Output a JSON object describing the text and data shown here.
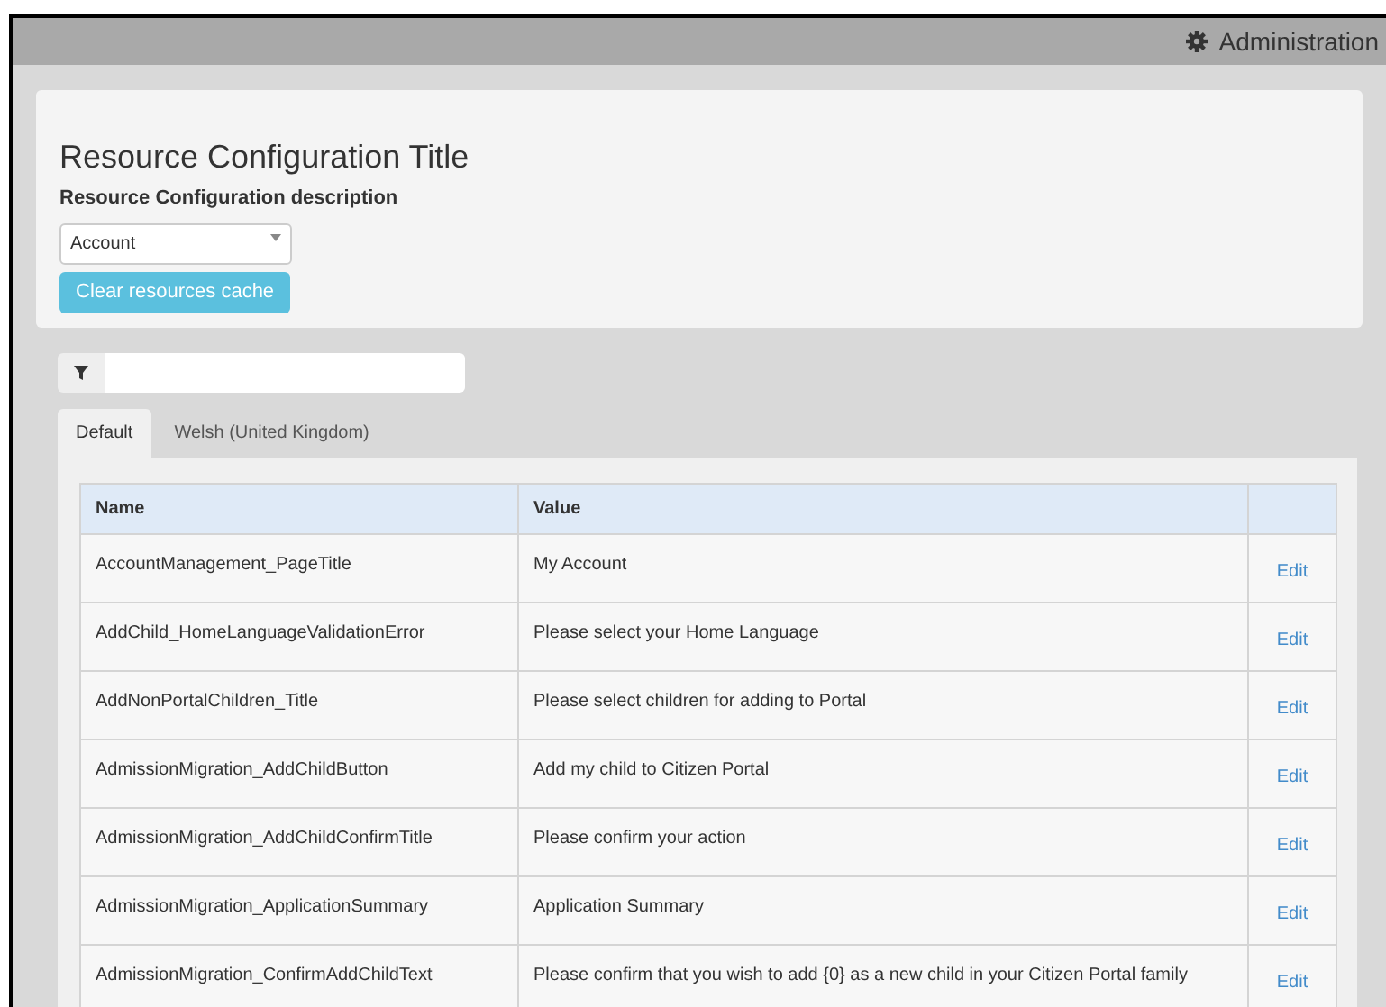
{
  "top_bar": {
    "admin_link": "Administration"
  },
  "panel": {
    "title": "Resource Configuration Title",
    "description": "Resource Configuration description",
    "dropdown": {
      "value": "Account"
    },
    "clear_button": "Clear resources cache"
  },
  "tabs": [
    {
      "label": "Default",
      "selected": true
    },
    {
      "label": "Welsh (United Kingdom)",
      "selected": false
    }
  ],
  "table": {
    "columns": [
      "Name",
      "Value",
      ""
    ],
    "rows": [
      {
        "name": "AccountManagement_PageTitle",
        "value": "My Account",
        "action": "Edit"
      },
      {
        "name": "AddChild_HomeLanguageValidationError",
        "value": "Please select your Home Language",
        "action": "Edit"
      },
      {
        "name": "AddNonPortalChildren_Title",
        "value": "Please select children for adding to Portal",
        "action": "Edit"
      },
      {
        "name": "AdmissionMigration_AddChildButton",
        "value": "Add my child to Citizen Portal",
        "action": "Edit"
      },
      {
        "name": "AdmissionMigration_AddChildConfirmTitle",
        "value": "Please confirm your action",
        "action": "Edit"
      },
      {
        "name": "AdmissionMigration_ApplicationSummary",
        "value": "Application Summary",
        "action": "Edit"
      },
      {
        "name": "AdmissionMigration_ConfirmAddChildText",
        "value": "Please confirm that you wish to add {0} as a new child in your Citizen Portal family",
        "action": "Edit"
      }
    ]
  }
}
